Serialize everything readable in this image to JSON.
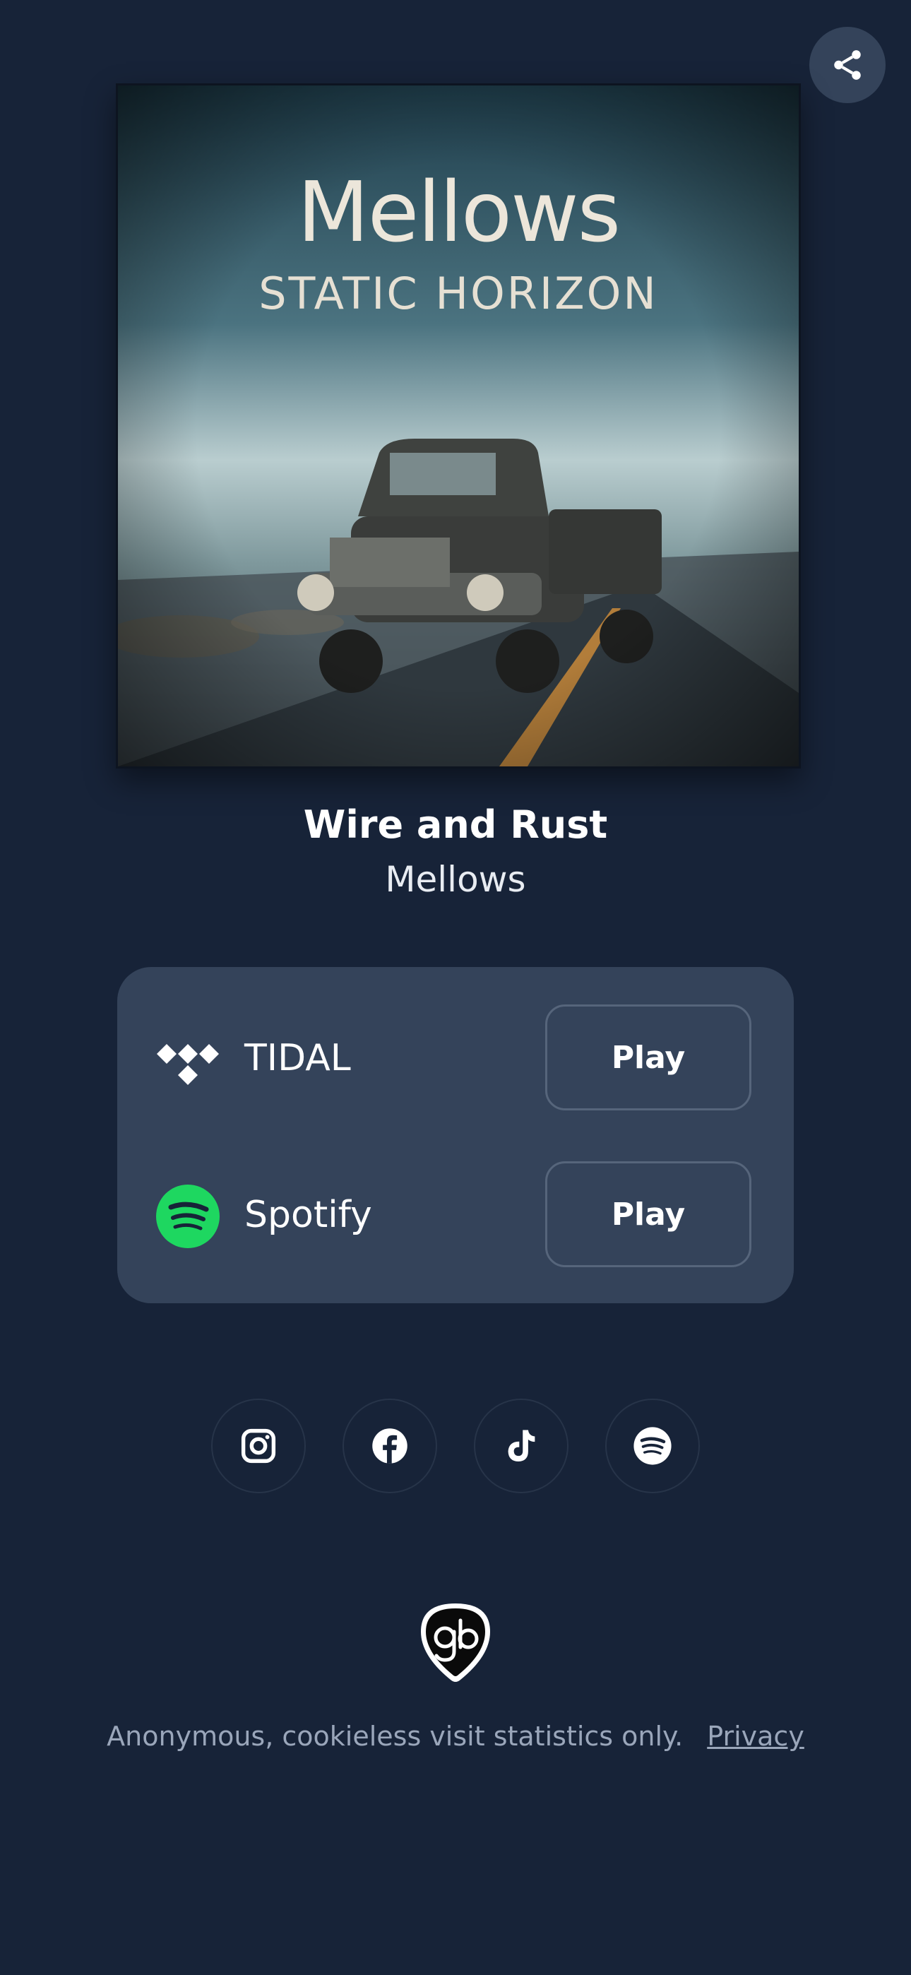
{
  "share": {
    "icon": "share-icon"
  },
  "cover": {
    "band": "Mellows",
    "album": "STATIC HORIZON"
  },
  "track": {
    "title": "Wire and Rust",
    "artist": "Mellows"
  },
  "services": [
    {
      "name": "TIDAL",
      "icon": "tidal-icon",
      "action": "Play"
    },
    {
      "name": "Spotify",
      "icon": "spotify-icon",
      "action": "Play",
      "color": "#1ed760"
    }
  ],
  "social": [
    {
      "icon": "instagram-icon"
    },
    {
      "icon": "facebook-icon"
    },
    {
      "icon": "tiktok-icon"
    },
    {
      "icon": "spotify-icon"
    }
  ],
  "footer": {
    "notice": "Anonymous, cookieless visit statistics only.",
    "privacy_link": "Privacy"
  },
  "colors": {
    "background": "#172338",
    "card": "#34435a",
    "spotify_green": "#1ed760"
  }
}
